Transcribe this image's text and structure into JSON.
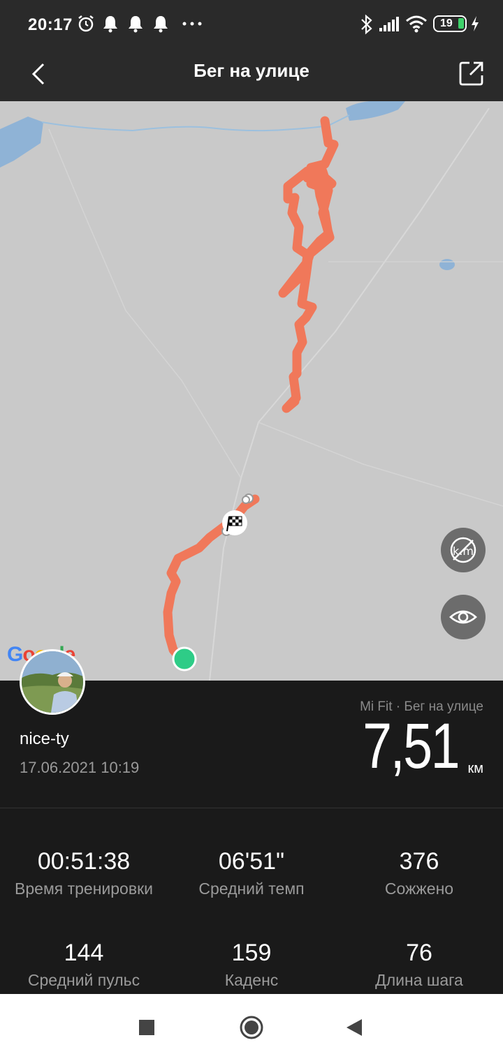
{
  "status_bar": {
    "time": "20:17",
    "battery": "19",
    "icons": [
      "alarm-icon",
      "bell-icon",
      "bell-icon",
      "bell-icon",
      "more-icon",
      "bluetooth-icon",
      "signal-icon",
      "wifi-icon",
      "battery-icon",
      "charging-icon"
    ]
  },
  "header": {
    "title": "Бег на улице",
    "back_icon": "chevron-left-icon",
    "share_icon": "share-icon"
  },
  "map": {
    "route_color": "#f0785a",
    "start_color": "#2ecc87",
    "buttons": [
      "hide-distance-markers-icon",
      "eye-icon"
    ],
    "logo": "Google"
  },
  "workout": {
    "username": "nice-ty",
    "datetime": "17.06.2021 10:19",
    "source": "Mi Fit · Бег на улице",
    "distance": "7,51",
    "unit": "км"
  },
  "stats": [
    {
      "value": "00:51:38",
      "label": "Время тренировки"
    },
    {
      "value": "06'51\"",
      "label": "Средний темп"
    },
    {
      "value": "376",
      "label": "Сожжено"
    },
    {
      "value": "144",
      "label": "Средний пульс"
    },
    {
      "value": "159",
      "label": "Каденс"
    },
    {
      "value": "76",
      "label": "Длина шага"
    }
  ],
  "nav": [
    "recents-square-icon",
    "home-circle-icon",
    "back-triangle-icon"
  ]
}
